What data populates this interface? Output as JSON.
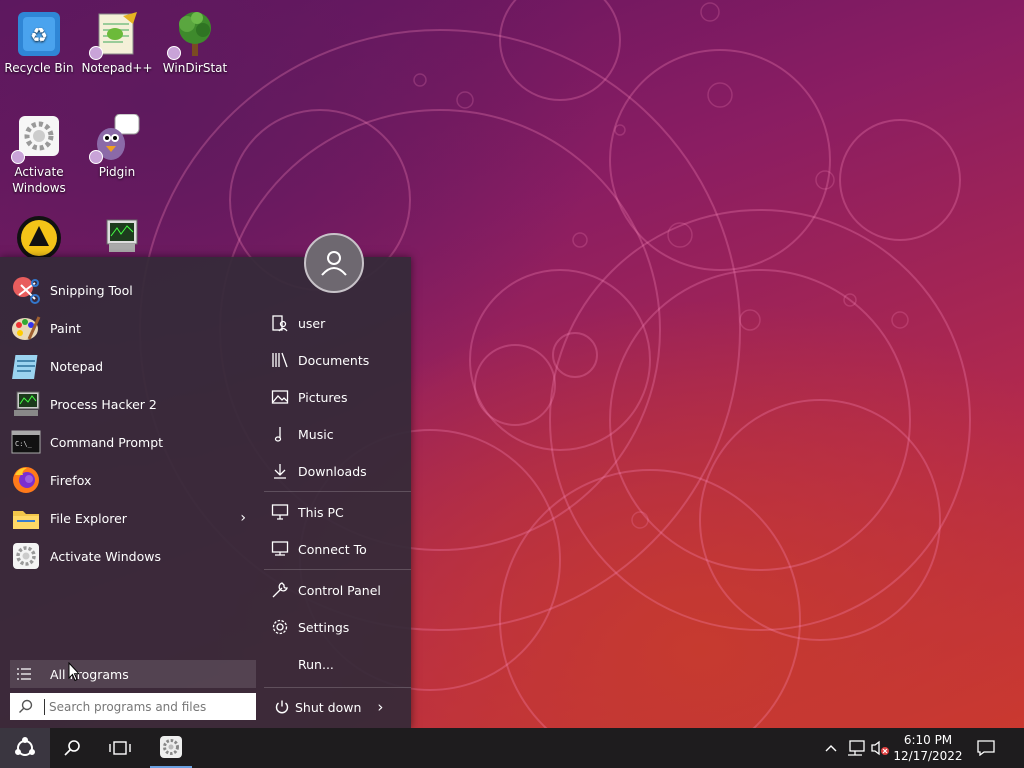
{
  "desktop": {
    "icons": [
      {
        "label": "Recycle Bin"
      },
      {
        "label": "Notepad++"
      },
      {
        "label": "WinDirStat"
      },
      {
        "label": "Activate Windows"
      },
      {
        "label": "Pidgin"
      }
    ]
  },
  "start_menu": {
    "programs": [
      {
        "label": "Snipping Tool",
        "icon": "scissors-icon"
      },
      {
        "label": "Paint",
        "icon": "paint-palette-icon"
      },
      {
        "label": "Notepad",
        "icon": "notepad-icon"
      },
      {
        "label": "Process Hacker 2",
        "icon": "monitor-icon"
      },
      {
        "label": "Command Prompt",
        "icon": "terminal-icon"
      },
      {
        "label": "Firefox",
        "icon": "firefox-icon"
      },
      {
        "label": "File Explorer",
        "icon": "folder-icon",
        "submenu": true
      },
      {
        "label": "Activate Windows",
        "icon": "gear-icon"
      }
    ],
    "all_programs": "All Programs",
    "search_placeholder": "Search programs and files",
    "places": [
      {
        "label": "user",
        "icon": "user-folder-icon"
      },
      {
        "label": "Documents",
        "icon": "library-icon"
      },
      {
        "label": "Pictures",
        "icon": "picture-icon"
      },
      {
        "label": "Music",
        "icon": "music-note-icon"
      },
      {
        "label": "Downloads",
        "icon": "download-icon"
      },
      {
        "label": "This PC",
        "icon": "computer-icon"
      },
      {
        "label": "Connect To",
        "icon": "network-icon"
      },
      {
        "label": "Control Panel",
        "icon": "wrench-icon"
      },
      {
        "label": "Settings",
        "icon": "gear-icon"
      },
      {
        "label": "Run...",
        "icon": "run-icon"
      }
    ],
    "shutdown": "Shut down"
  },
  "taskbar": {
    "time": "6:10 PM",
    "date": "12/17/2022"
  }
}
